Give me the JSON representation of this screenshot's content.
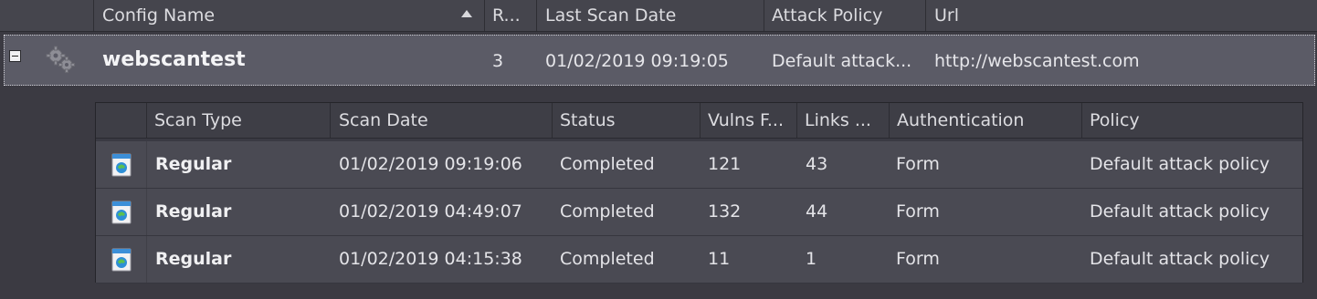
{
  "outer_grid": {
    "columns": {
      "config_name": "Config Name",
      "r": "R...",
      "last_scan_date": "Last Scan Date",
      "attack_policy": "Attack Policy",
      "url": "Url"
    },
    "sort_direction": "ascending"
  },
  "group": {
    "expanded": true,
    "icon": "gears-icon",
    "config_name": "webscantest",
    "r": "3",
    "last_scan_date": "01/02/2019 09:19:05",
    "attack_policy": "Default attack...",
    "url": "http://webscantest.com"
  },
  "child_grid": {
    "columns": {
      "scan_type": "Scan Type",
      "scan_date": "Scan Date",
      "status": "Status",
      "vulns": "Vulns F...",
      "links": "Links ...",
      "authentication": "Authentication",
      "policy": "Policy"
    },
    "rows": [
      {
        "icon": "scan-document-icon",
        "scan_type": "Regular",
        "scan_date": "01/02/2019 09:19:06",
        "status": "Completed",
        "vulns": "121",
        "links": "43",
        "authentication": "Form",
        "policy": "Default attack policy"
      },
      {
        "icon": "scan-document-icon",
        "scan_type": "Regular",
        "scan_date": "01/02/2019 04:49:07",
        "status": "Completed",
        "vulns": "132",
        "links": "44",
        "authentication": "Form",
        "policy": "Default attack policy"
      },
      {
        "icon": "scan-document-icon",
        "scan_type": "Regular",
        "scan_date": "01/02/2019 04:15:38",
        "status": "Completed",
        "vulns": "11",
        "links": "1",
        "authentication": "Form",
        "policy": "Default attack policy"
      }
    ]
  }
}
